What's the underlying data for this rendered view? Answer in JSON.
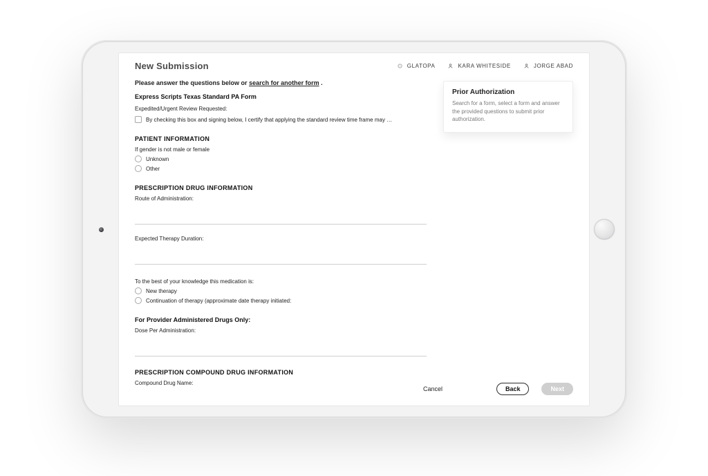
{
  "header": {
    "title": "New Submission",
    "chips": [
      {
        "id": "drug",
        "label": "GLATOPA",
        "icon": "sparkle"
      },
      {
        "id": "member",
        "label": "KARA WHITESIDE",
        "icon": "user"
      },
      {
        "id": "provider",
        "label": "JORGE ABAD",
        "icon": "user"
      }
    ]
  },
  "side": {
    "title": "Prior Authorization",
    "text": "Search for a form, select a form and answer the provided questions to submit prior authorization."
  },
  "intro": {
    "prefix": "Please answer the questions below or ",
    "link_text": "search for another form",
    "suffix": " ."
  },
  "form": {
    "title": "Express Scripts Texas Standard PA Form",
    "expedited_label": "Expedited/Urgent Review Requested:",
    "expedited_checkbox_text": "By checking this box and signing below, I certify that applying the standard review time frame may seriously jeo",
    "sections": {
      "patient_info": {
        "heading": "PATIENT INFORMATION",
        "gender_label": "If gender is not male or female",
        "gender_options": [
          "Unknown",
          "Other"
        ]
      },
      "rx_info": {
        "heading": "PRESCRIPTION DRUG INFORMATION",
        "route_label": "Route of Administration:",
        "duration_label": "Expected Therapy Duration:",
        "medication_is_label": "To the best of your knowledge this medication is:",
        "medication_is_options": [
          "New therapy",
          "Continuation of therapy (approximate date therapy initiated:"
        ],
        "provider_admin_heading": "For Provider Administered Drugs Only:",
        "dose_label": "Dose Per Administration:"
      },
      "compound_info": {
        "heading": "PRESCRIPTION COMPOUND DRUG INFORMATION",
        "compound_name_label": "Compound Drug Name:"
      }
    }
  },
  "footer": {
    "cancel": "Cancel",
    "back": "Back",
    "next": "Next"
  }
}
